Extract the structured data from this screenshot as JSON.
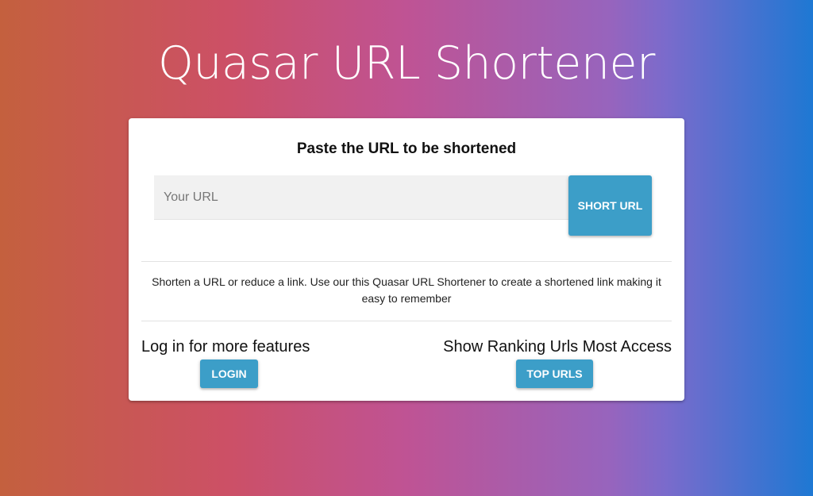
{
  "header": {
    "title": "Quasar URL Shortener"
  },
  "card": {
    "heading": "Paste the URL to be shortened",
    "url_input": {
      "placeholder": "Your URL",
      "value": ""
    },
    "short_button_label": "SHORT URL",
    "description": "Shorten a URL or reduce a link. Use our this Quasar URL Shortener to create a shortened link making it easy to remember",
    "login_section": {
      "text": "Log in for more features",
      "button_label": "LOGIN"
    },
    "ranking_section": {
      "text": "Show Ranking Urls Most Access",
      "button_label": "TOP URLS"
    }
  },
  "colors": {
    "accent": "#3c9ec8",
    "gradient_start": "#c4603e",
    "gradient_end": "#1e78d3"
  }
}
